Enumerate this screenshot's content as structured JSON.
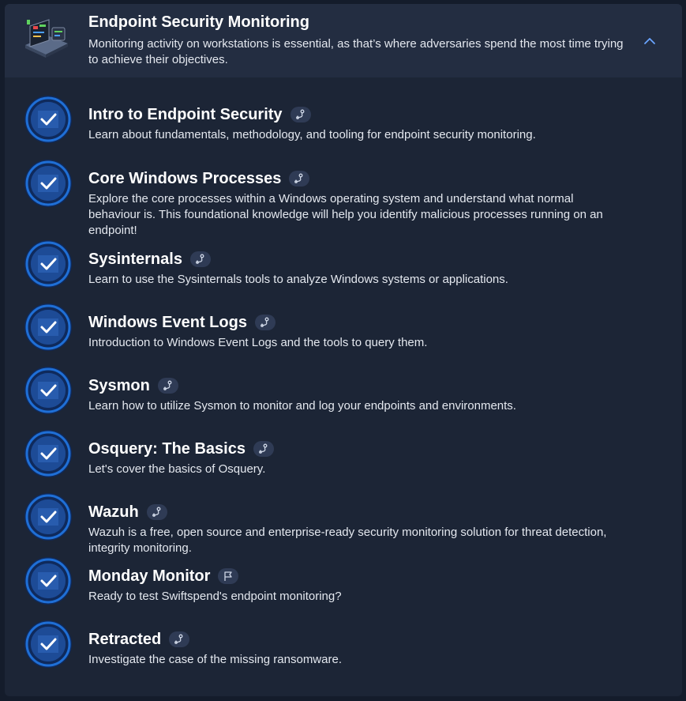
{
  "module": {
    "title": "Endpoint Security Monitoring",
    "description": "Monitoring activity on workstations is essential, as that’s where adversaries spend the most time trying to achieve their objectives.",
    "icon": "laptop-dashboard-icon",
    "collapse_icon": "chevron-up-icon"
  },
  "colors": {
    "page_bg": "#141c2b",
    "panel_bg": "#1c2536",
    "header_bg": "#232d41",
    "badge_blue": "#1f6fd6",
    "badge_dark": "#0f2a5c",
    "pill_bg": "#2f3b55",
    "accent_chevron": "#6aa5ff"
  },
  "rooms": [
    {
      "title": "Intro to Endpoint Security",
      "description": "Learn about fundamentals, methodology, and tooling for endpoint security monitoring.",
      "type_icon": "walkthrough-icon",
      "completed": true
    },
    {
      "title": "Core Windows Processes",
      "description": "Explore the core processes within a Windows operating system and understand what normal behaviour is. This foundational knowledge will help you identify malicious processes running on an endpoint!",
      "type_icon": "walkthrough-icon",
      "completed": true
    },
    {
      "title": "Sysinternals",
      "description": "Learn to use the Sysinternals tools to analyze Windows systems or applications.",
      "type_icon": "walkthrough-icon",
      "completed": true
    },
    {
      "title": "Windows Event Logs",
      "description": "Introduction to Windows Event Logs and the tools to query them.",
      "type_icon": "walkthrough-icon",
      "completed": true
    },
    {
      "title": "Sysmon",
      "description": "Learn how to utilize Sysmon to monitor and log your endpoints and environments.",
      "type_icon": "walkthrough-icon",
      "completed": true
    },
    {
      "title": "Osquery: The Basics",
      "description": "Let's cover the basics of Osquery.",
      "type_icon": "walkthrough-icon",
      "completed": true
    },
    {
      "title": "Wazuh",
      "description": "Wazuh is a free, open source and enterprise-ready security monitoring solution for threat detection, integrity monitoring.",
      "type_icon": "walkthrough-icon",
      "completed": true
    },
    {
      "title": "Monday Monitor",
      "description": "Ready to test Swiftspend's endpoint monitoring?",
      "type_icon": "flag-icon",
      "completed": true
    },
    {
      "title": "Retracted",
      "description": "Investigate the case of the missing ransomware.",
      "type_icon": "walkthrough-icon",
      "completed": true
    }
  ]
}
